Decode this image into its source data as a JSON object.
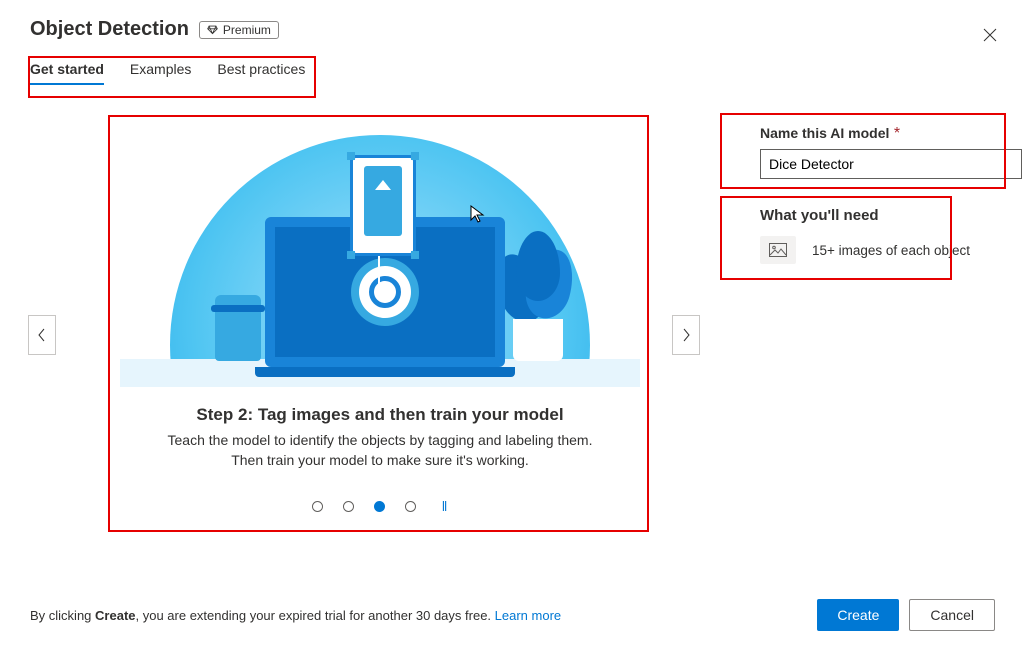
{
  "header": {
    "title": "Object Detection",
    "premium_label": "Premium"
  },
  "tabs": {
    "get_started": "Get started",
    "examples": "Examples",
    "best_practices": "Best practices"
  },
  "carousel": {
    "step_title": "Step 2: Tag images and then train your model",
    "step_desc": "Teach the model to identify the objects by tagging and labeling them. Then train your model to make sure it's working.",
    "active_index": 2,
    "total": 4
  },
  "form": {
    "name_label": "Name this AI model",
    "name_value": "Dice Detector",
    "need_title": "What you'll need",
    "need_item": "15+ images of each object"
  },
  "footer": {
    "text_before": "By clicking ",
    "text_bold": "Create",
    "text_after": ", you are extending your expired trial for another 30 days free. ",
    "learn_more": "Learn more",
    "create": "Create",
    "cancel": "Cancel"
  }
}
